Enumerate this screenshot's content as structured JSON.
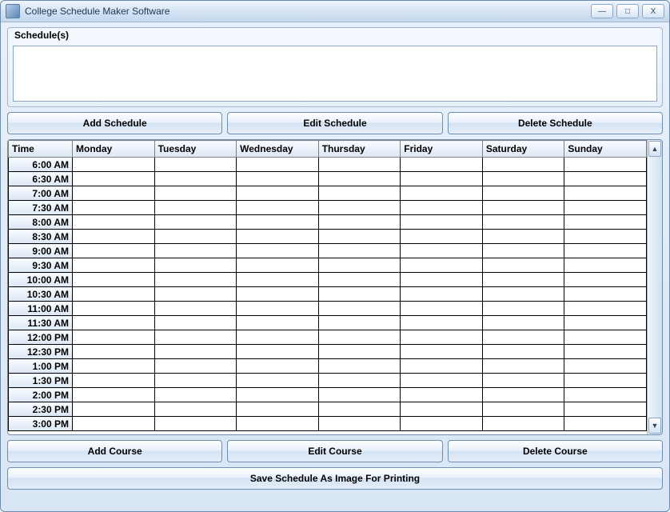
{
  "window": {
    "title": "College Schedule Maker Software"
  },
  "group": {
    "label": "Schedule(s)"
  },
  "buttons": {
    "add_schedule": "Add Schedule",
    "edit_schedule": "Edit Schedule",
    "delete_schedule": "Delete Schedule",
    "add_course": "Add Course",
    "edit_course": "Edit Course",
    "delete_course": "Delete Course",
    "save_image": "Save Schedule As Image For Printing"
  },
  "grid": {
    "headers": [
      "Time",
      "Monday",
      "Tuesday",
      "Wednesday",
      "Thursday",
      "Friday",
      "Saturday",
      "Sunday"
    ],
    "times": [
      "6:00 AM",
      "6:30 AM",
      "7:00 AM",
      "7:30 AM",
      "8:00 AM",
      "8:30 AM",
      "9:00 AM",
      "9:30 AM",
      "10:00 AM",
      "10:30 AM",
      "11:00 AM",
      "11:30 AM",
      "12:00 PM",
      "12:30 PM",
      "1:00 PM",
      "1:30 PM",
      "2:00 PM",
      "2:30 PM",
      "3:00 PM"
    ]
  },
  "win_controls": {
    "min": "—",
    "max": "□",
    "close": "X"
  },
  "scroll": {
    "up": "▲",
    "down": "▼"
  }
}
